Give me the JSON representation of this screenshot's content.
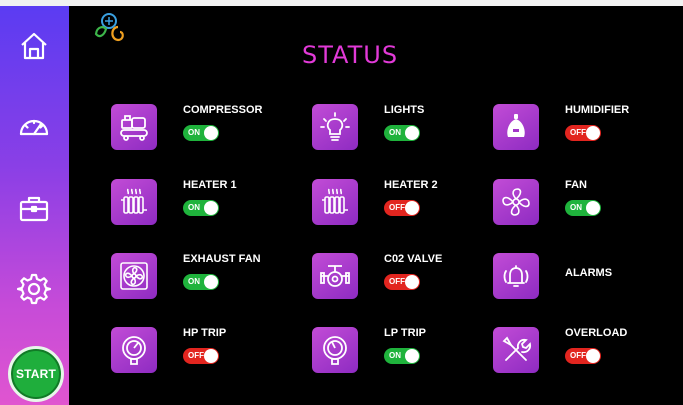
{
  "title": "STATUS",
  "sidebar": {
    "items": [
      {
        "icon": "home-icon"
      },
      {
        "icon": "gauge-icon"
      },
      {
        "icon": "toolbox-icon"
      },
      {
        "icon": "gear-icon"
      }
    ],
    "start_label": "START"
  },
  "colors": {
    "title": "#e23ad8",
    "tile": "#b03fd0",
    "on": "#1fb33c",
    "off": "#e2251f",
    "start": "#1fae3c"
  },
  "items": [
    {
      "label": "COMPRESSOR",
      "state": "ON",
      "icon": "compressor-icon"
    },
    {
      "label": "LIGHTS",
      "state": "ON",
      "icon": "light-bulb-icon"
    },
    {
      "label": "HUMIDIFIER",
      "state": "OFF",
      "icon": "humidifier-icon"
    },
    {
      "label": "HEATER 1",
      "state": "ON",
      "icon": "heater-icon"
    },
    {
      "label": "HEATER 2",
      "state": "OFF",
      "icon": "heater-icon"
    },
    {
      "label": "FAN",
      "state": "ON",
      "icon": "fan-icon"
    },
    {
      "label": "EXHAUST FAN",
      "state": "ON",
      "icon": "exhaust-fan-icon"
    },
    {
      "label": "C02 VALVE",
      "state": "OFF",
      "icon": "valve-icon"
    },
    {
      "label": "ALARMS",
      "state": "",
      "icon": "alarm-bell-icon"
    },
    {
      "label": "HP TRIP",
      "state": "OFF",
      "icon": "pressure-gauge-icon"
    },
    {
      "label": "LP TRIP",
      "state": "ON",
      "icon": "pressure-gauge-icon"
    },
    {
      "label": "OVERLOAD",
      "state": "OFF",
      "icon": "tools-icon"
    }
  ]
}
